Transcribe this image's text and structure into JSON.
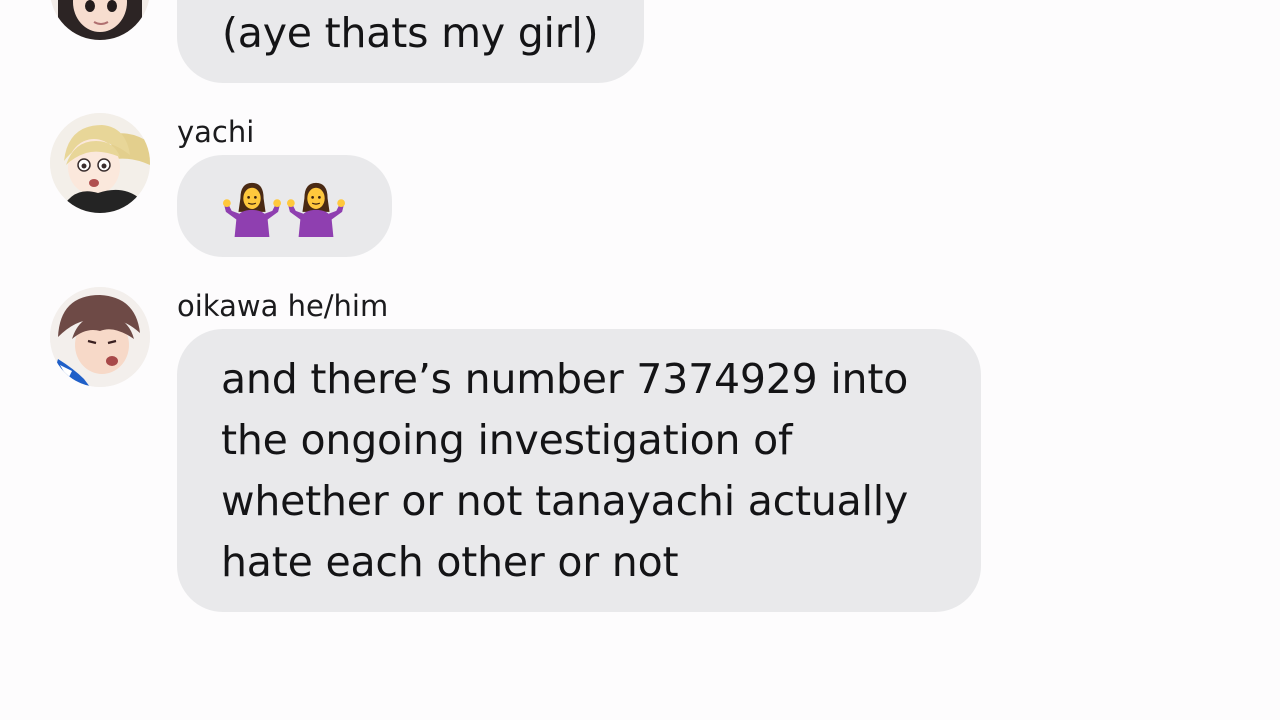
{
  "messages": [
    {
      "sender": "",
      "avatar_icon": "girl-avatar-icon",
      "text": "(aye thats my girl)"
    },
    {
      "sender": "yachi",
      "avatar_icon": "yachi-avatar-icon",
      "emojis": [
        "woman-shrugging-icon",
        "woman-shrugging-icon"
      ],
      "text": "🤷‍♀️🤷‍♀️"
    },
    {
      "sender": "oikawa he/him",
      "avatar_icon": "oikawa-avatar-icon",
      "text": "and there’s number 7374929 into\nthe ongoing investigation of\nwhether or not tanayachi actually\nhate each other or not"
    }
  ],
  "colors": {
    "background": "#fdfcfd",
    "bubble": "#e9e9eb",
    "text": "#141416",
    "emoji": "#8f3fb0"
  }
}
